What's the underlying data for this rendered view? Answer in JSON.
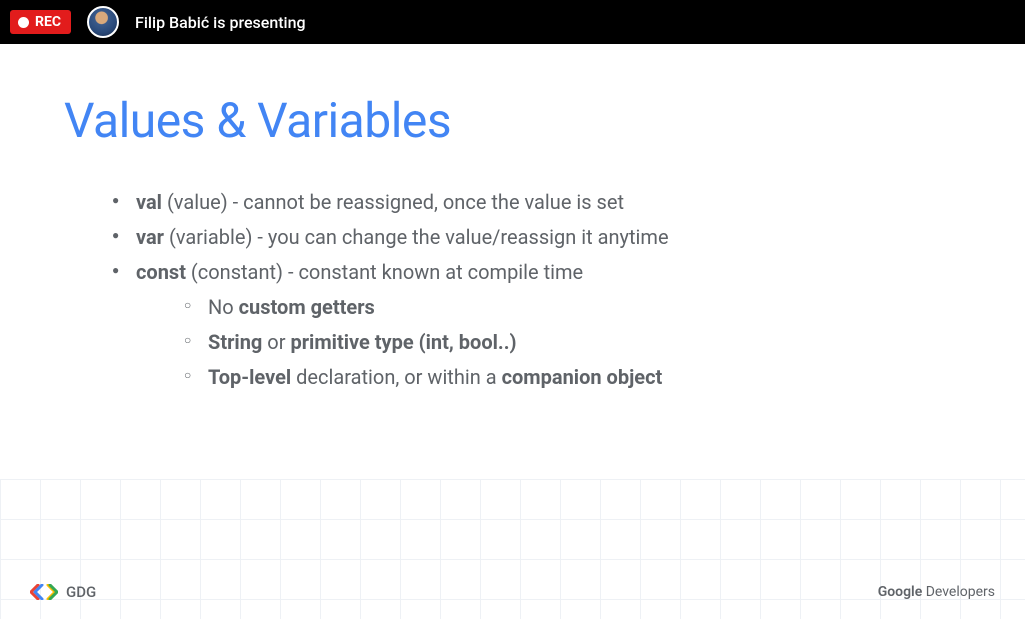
{
  "topbar": {
    "rec_label": "REC",
    "presenting_text": "Filip Babić is presenting"
  },
  "slide": {
    "title": "Values & Variables",
    "bullets": [
      {
        "bold": "val",
        "plain1": " (value) - cannot be reassigned, once the value is set"
      },
      {
        "bold": "var",
        "plain1": " (variable) - you can change the value/reassign it anytime"
      },
      {
        "bold": "const",
        "plain1": " (constant) - constant known at compile time"
      }
    ],
    "subbullets": [
      {
        "p1": "No ",
        "b1": "custom getters"
      },
      {
        "b1": "String",
        "p1": " or ",
        "b2": "primitive type (int, bool..)"
      },
      {
        "b1": "Top-level",
        "p1": " declaration, or within a ",
        "b2": "companion object"
      }
    ]
  },
  "footer": {
    "gdg": "GDG",
    "google": "Google",
    "developers": " Developers"
  }
}
